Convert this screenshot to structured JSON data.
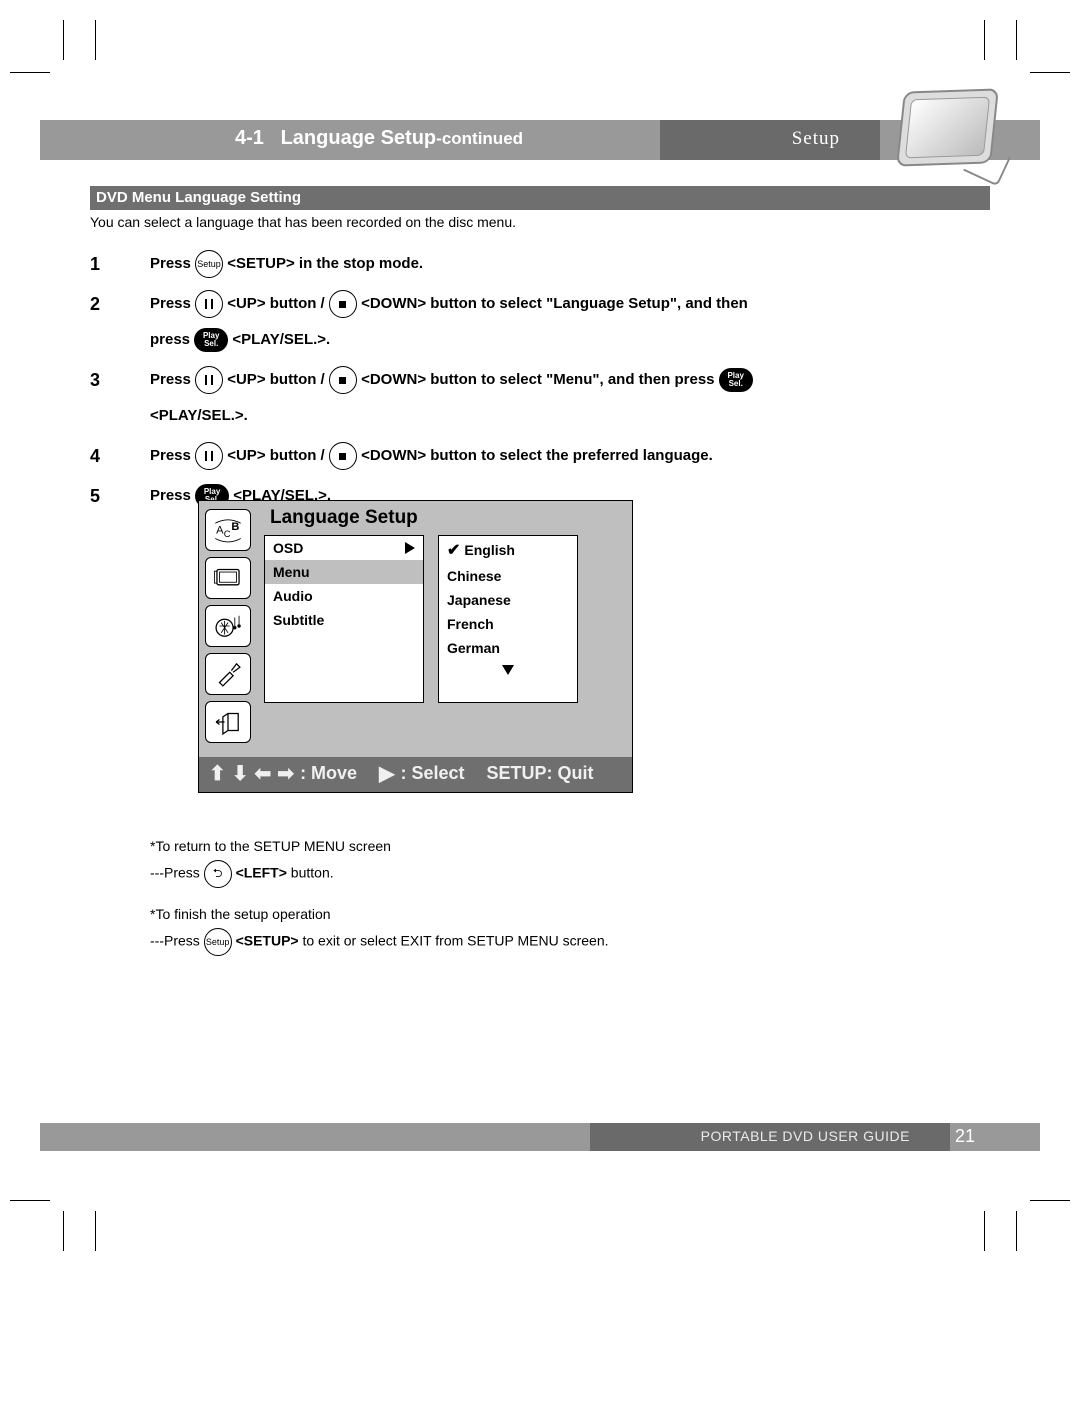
{
  "header": {
    "section_no": "4-1",
    "section_title": "Language Setup",
    "continued": "-continued",
    "category": "Setup"
  },
  "subheader": "DVD Menu Language Setting",
  "intro": "You can select a language that has been recorded on the disc menu.",
  "buttons": {
    "setup": "Setup",
    "play_sel_top": "Play",
    "play_sel_bot": "Sel."
  },
  "labels": {
    "press": "Press",
    "press_lower": "press",
    "setup_tag": "<SETUP>",
    "up": "<UP>",
    "down": "<DOWN>",
    "playsel": "<PLAY/SEL.>",
    "left": "<LEFT>",
    "button_word": "button",
    "slash": " / ",
    "in_stop": " in the stop mode.",
    "sel_lang_setup": " button to select \"Language Setup\", and then",
    "sel_menu": " button to select \"Menu\", and then press",
    "sel_pref": " button to select the preferred language.",
    "dot": "."
  },
  "step_nums": {
    "s1": "1",
    "s2": "2",
    "s3": "3",
    "s4": "4",
    "s5": "5"
  },
  "osd": {
    "title": "Language Setup",
    "left_items": [
      "OSD",
      "Menu",
      "Audio",
      "Subtitle"
    ],
    "selected_left": "Menu",
    "right_items": [
      "English",
      "Chinese",
      "Japanese",
      "French",
      "German"
    ],
    "checked_right": "English",
    "footer_move": ": Move",
    "footer_select": ": Select",
    "footer_quit": "SETUP: Quit"
  },
  "notes": {
    "n1_title": "*To return to the SETUP MENU screen",
    "n1_line_a": "---Press",
    "n1_line_b": " button.",
    "n2_title": "*To finish the setup operation",
    "n2_line_a": "---Press",
    "n2_line_b": " to exit or select EXIT from SETUP MENU screen."
  },
  "footer": {
    "guide": "PORTABLE DVD USER GUIDE",
    "page": "21"
  }
}
